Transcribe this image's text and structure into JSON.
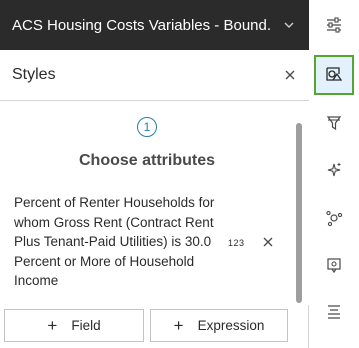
{
  "layer": {
    "title": "ACS Housing Costs Variables - Bound..."
  },
  "styles_panel": {
    "title": "Styles",
    "step_number": "1",
    "step_title": "Choose attributes",
    "attribute": {
      "name": "Percent of Renter Households for whom Gross Rent (Contract Rent Plus Tenant-Paid Utilities) is 30.0 Percent or More of Household Income",
      "type_badge": "123"
    },
    "buttons": {
      "field_label": "Field",
      "expression_label": "Expression"
    }
  },
  "toolbar": {
    "tools": [
      {
        "icon": "properties-icon",
        "active": false
      },
      {
        "icon": "styles-icon",
        "active": true
      },
      {
        "icon": "filter-icon",
        "active": false
      },
      {
        "icon": "effects-icon",
        "active": false
      },
      {
        "icon": "clustering-icon",
        "active": false
      },
      {
        "icon": "popups-icon",
        "active": false
      },
      {
        "icon": "labels-icon",
        "active": false
      }
    ]
  },
  "colors": {
    "header_bg": "#2b2b2b",
    "accent_blue": "#2a7fa8",
    "active_tool_border": "#55a630"
  }
}
